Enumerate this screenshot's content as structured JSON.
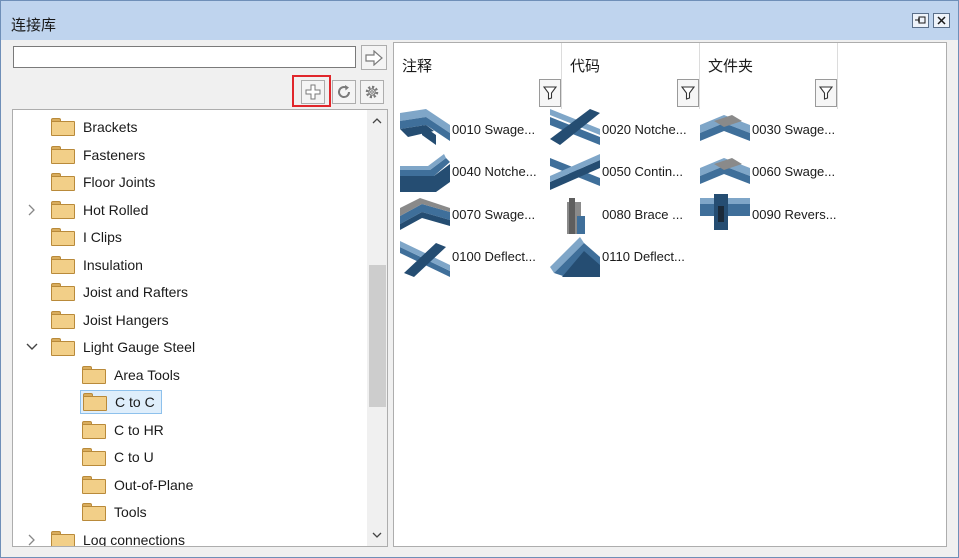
{
  "window": {
    "title": "连接库"
  },
  "left": {
    "search": {
      "value": "",
      "placeholder": ""
    },
    "tree": [
      {
        "label": "Brackets",
        "level": 1,
        "expander": ""
      },
      {
        "label": "Fasteners",
        "level": 1,
        "expander": ""
      },
      {
        "label": "Floor Joints",
        "level": 1,
        "expander": ""
      },
      {
        "label": "Hot Rolled",
        "level": 1,
        "expander": "collapsed"
      },
      {
        "label": "I Clips",
        "level": 1,
        "expander": ""
      },
      {
        "label": "Insulation",
        "level": 1,
        "expander": ""
      },
      {
        "label": "Joist and Rafters",
        "level": 1,
        "expander": ""
      },
      {
        "label": "Joist Hangers",
        "level": 1,
        "expander": ""
      },
      {
        "label": "Light Gauge Steel",
        "level": 1,
        "expander": "expanded"
      },
      {
        "label": "Area Tools",
        "level": 2,
        "expander": ""
      },
      {
        "label": "C to C",
        "level": 2,
        "expander": "",
        "selected": true
      },
      {
        "label": "C to HR",
        "level": 2,
        "expander": ""
      },
      {
        "label": "C to U",
        "level": 2,
        "expander": ""
      },
      {
        "label": "Out-of-Plane",
        "level": 2,
        "expander": ""
      },
      {
        "label": "Tools",
        "level": 2,
        "expander": ""
      },
      {
        "label": "Log connections",
        "level": 1,
        "expander": "collapsed"
      }
    ]
  },
  "right": {
    "columns": [
      {
        "label": "注释"
      },
      {
        "label": "代码"
      },
      {
        "label": "文件夹"
      }
    ],
    "items": [
      {
        "label": "0010 Swage...",
        "thumb": "swage-beam"
      },
      {
        "label": "0020 Notche...",
        "thumb": "notched-cross"
      },
      {
        "label": "0030 Swage...",
        "thumb": "swage-grey"
      },
      {
        "label": "0040 Notche...",
        "thumb": "notched-bend"
      },
      {
        "label": "0050 Contin...",
        "thumb": "continuous-cross"
      },
      {
        "label": "0060 Swage...",
        "thumb": "swage-grey"
      },
      {
        "label": "0070 Swage...",
        "thumb": "swage-roof"
      },
      {
        "label": "0080 Brace ...",
        "thumb": "brace-vertical"
      },
      {
        "label": "0090 Revers...",
        "thumb": "reverse-beam"
      },
      {
        "label": "0100 Deflect...",
        "thumb": "deflection-cross"
      },
      {
        "label": "0110 Deflect...",
        "thumb": "deflection-angle"
      }
    ]
  },
  "colors": {
    "titlebar": "#bfd4ee",
    "highlight": "#e0262b",
    "steel": "#3f6f9a",
    "folder": "#f2cf88"
  }
}
